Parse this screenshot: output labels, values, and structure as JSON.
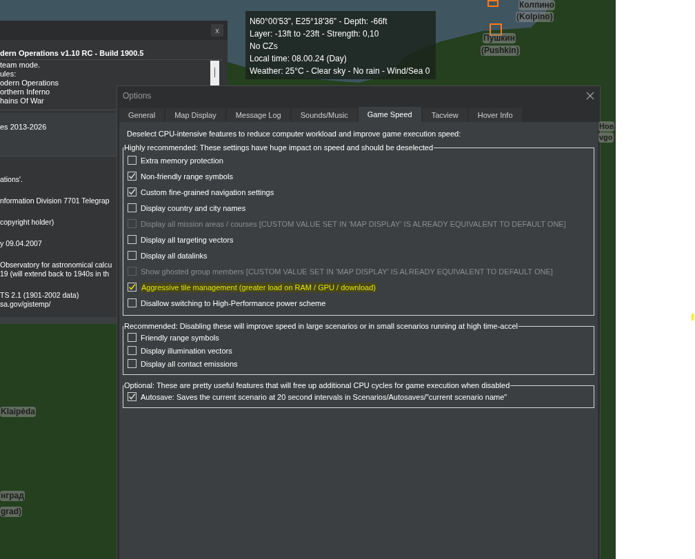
{
  "map": {
    "labels": [
      {
        "kind": "city",
        "text": "Колпино"
      },
      {
        "kind": "city",
        "text": "(Kolpino)"
      },
      {
        "kind": "city",
        "text": "Пушкин"
      },
      {
        "kind": "city",
        "text": "(Pushkin)"
      },
      {
        "kind": "city",
        "text": "Нов"
      },
      {
        "kind": "city",
        "text": "vgo"
      },
      {
        "kind": "city",
        "text": "Klaipėda"
      },
      {
        "kind": "city",
        "text": "нград"
      },
      {
        "kind": "city",
        "text": "grad)"
      }
    ]
  },
  "hover_info": {
    "lines": [
      "N60°00'53\", E25°18'36\" - Depth: -66ft",
      "Layer: -13ft to -23ft - Strength: 0,10",
      "No CZs",
      "Local time: 08.00.24 (Day)",
      "Weather: 25°C - Clear sky - No rain - Wind/Sea 0"
    ]
  },
  "about_window": {
    "close": "x",
    "header": "dern Operations v1.10 RC - Build 1900.5",
    "list_lines": [
      "team mode.",
      "ules:",
      "odern Operations",
      "orthern Inferno",
      "hains Of War"
    ],
    "band": "es 2013-2026",
    "paragraphs": [
      [
        "ations'."
      ],
      [
        "nformation Division 7701 Telegrap"
      ],
      [
        "copyright holder)"
      ],
      [
        "y 09.04.2007"
      ],
      [
        "Observatory for astronomical calcu",
        "19 (will extend back to 1940s in th"
      ],
      [
        "TS 2.1 (1901-2002 data)",
        "sa.gov/gistemp/"
      ]
    ]
  },
  "options_window": {
    "title": "Options",
    "tabs": [
      {
        "label": "General",
        "selected": false
      },
      {
        "label": "Map Display",
        "selected": false
      },
      {
        "label": "Message Log",
        "selected": false
      },
      {
        "label": "Sounds/Music",
        "selected": false
      },
      {
        "label": "Game Speed",
        "selected": true
      },
      {
        "label": "Tacview",
        "selected": false
      },
      {
        "label": "Hover Info",
        "selected": false
      }
    ],
    "intro": "Deselect CPU-intensive features to reduce computer workload and improve game execution speed:",
    "groups": [
      {
        "legend": "Highly recommended: These settings have huge impact on speed and should be deselected",
        "items": [
          {
            "label": "Extra memory protection",
            "checked": false,
            "disabled": false,
            "highlighted": false
          },
          {
            "label": "Non-friendly range symbols",
            "checked": true,
            "disabled": false,
            "highlighted": false
          },
          {
            "label": "Custom fine-grained navigation settings",
            "checked": true,
            "disabled": false,
            "highlighted": false
          },
          {
            "label": "Display country and city names",
            "checked": false,
            "disabled": false,
            "highlighted": false
          },
          {
            "label": "Display all mission areas / courses [CUSTOM VALUE SET IN 'MAP DISPLAY' IS ALREADY EQUIVALENT TO DEFAULT ONE]",
            "checked": false,
            "disabled": true,
            "highlighted": false
          },
          {
            "label": "Display all targeting vectors",
            "checked": false,
            "disabled": false,
            "highlighted": false
          },
          {
            "label": "Display all datalinks",
            "checked": false,
            "disabled": false,
            "highlighted": false
          },
          {
            "label": "Show ghosted group members [CUSTOM VALUE SET IN 'MAP DISPLAY' IS ALREADY EQUIVALENT TO DEFAULT ONE]",
            "checked": false,
            "disabled": true,
            "highlighted": false
          },
          {
            "label": "Aggressive tile management (greater load on RAM / GPU / download)",
            "checked": true,
            "disabled": false,
            "highlighted": true
          },
          {
            "label": "Disallow switching to High-Performance power scheme",
            "checked": false,
            "disabled": false,
            "highlighted": false
          }
        ]
      },
      {
        "legend": "Recommended: Disabling these will improve speed in large scenarios or in small scenarios running at high time-accel",
        "items": [
          {
            "label": "Friendly range symbols",
            "checked": false,
            "disabled": false,
            "highlighted": false
          },
          {
            "label": "Display illumination vectors",
            "checked": false,
            "disabled": false,
            "highlighted": false
          },
          {
            "label": "Display all contact emissions",
            "checked": false,
            "disabled": false,
            "highlighted": false
          }
        ]
      },
      {
        "legend": "Optional: These are pretty useful features that will free up additional CPU cycles for game execution when disabled",
        "items": [
          {
            "label": "Autosave: Saves the current scenario at 20 second intervals in Scenarios/Autosaves/\"current scenario name\"",
            "checked": true,
            "disabled": false,
            "highlighted": false
          }
        ]
      }
    ]
  }
}
